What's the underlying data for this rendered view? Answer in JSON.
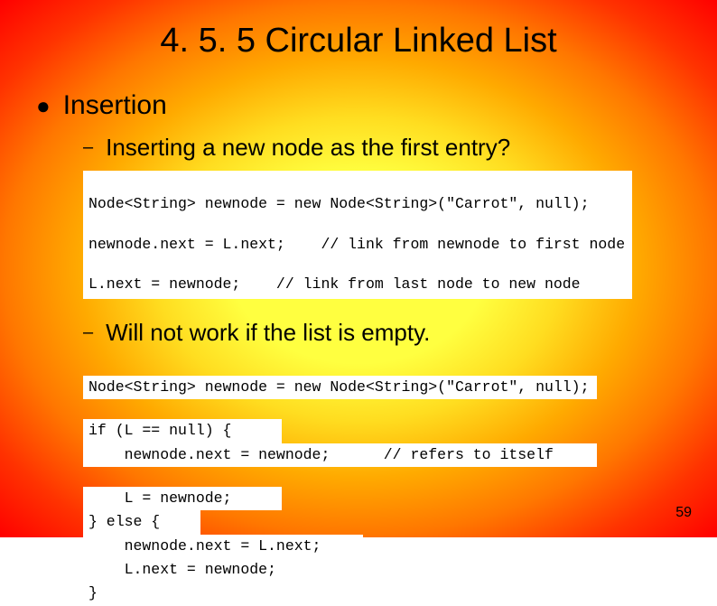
{
  "title": "4. 5. 5 Circular Linked List",
  "bullet": {
    "label": "Insertion",
    "subs": [
      {
        "label": "Inserting a new node as the first entry?"
      },
      {
        "label": "Will not work if the list is empty."
      }
    ]
  },
  "code1": [
    "Node<String> newnode = new Node<String>(\"Carrot\", null);",
    "newnode.next = L.next;    // link from newnode to first node",
    "L.next = newnode;    // link from last node to new node"
  ],
  "code2": [
    "Node<String> newnode = new Node<String>(\"Carrot\", null);",
    "if (L == null) {",
    "    newnode.next = newnode;      // refers to itself",
    "    L = newnode;",
    "} else {",
    "    newnode.next = L.next;",
    "    L.next = newnode;",
    "}"
  ],
  "page_number": "59"
}
